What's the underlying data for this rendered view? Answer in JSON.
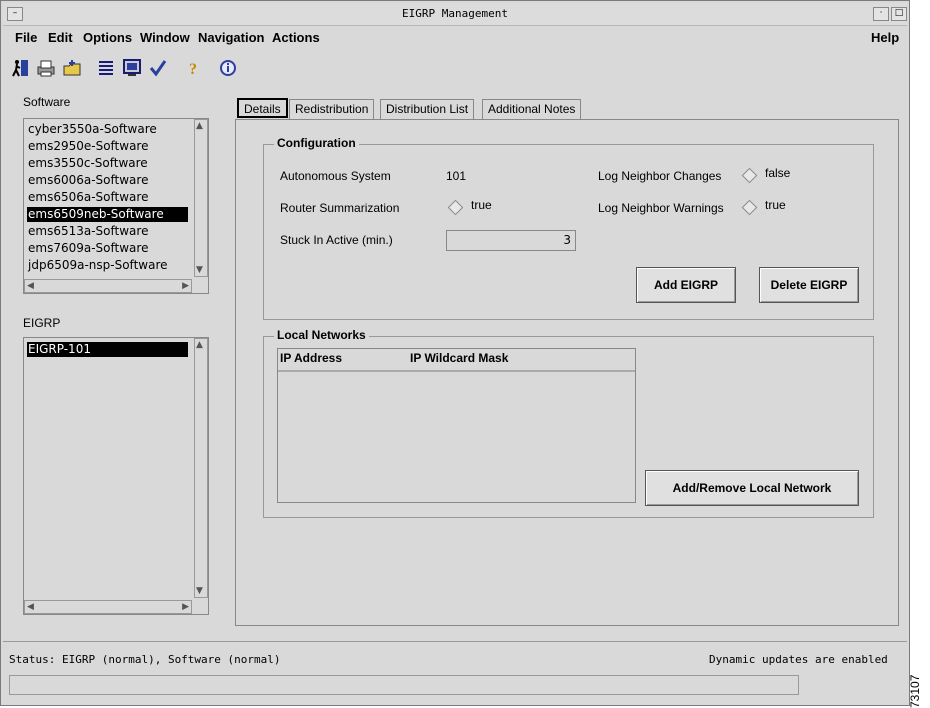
{
  "window": {
    "title": "EIGRP Management"
  },
  "menu": {
    "file": "File",
    "edit": "Edit",
    "options": "Options",
    "window": "Window",
    "navigation": "Navigation",
    "actions": "Actions",
    "help": "Help"
  },
  "toolbar": {
    "icons": [
      "exit-icon",
      "print-icon",
      "folder-icon",
      "list-icon",
      "monitor-icon",
      "check-icon",
      "help-icon",
      "info-icon"
    ]
  },
  "software": {
    "label": "Software",
    "items": [
      "cyber3550a-Software",
      "ems2950e-Software",
      "ems3550c-Software",
      "ems6006a-Software",
      "ems6506a-Software",
      "ems6509neb-Software",
      "ems6513a-Software",
      "ems7609a-Software",
      "jdp6509a-nsp-Software"
    ],
    "selected": "ems6509neb-Software"
  },
  "eigrp": {
    "label": "EIGRP",
    "items": [
      "EIGRP-101"
    ],
    "selected": "EIGRP-101"
  },
  "tabs": [
    "Details",
    "Redistribution",
    "Distribution List",
    "Additional Notes"
  ],
  "configuration": {
    "title": "Configuration",
    "autonomous_system_label": "Autonomous System",
    "autonomous_system_value": "101",
    "router_summarization_label": "Router Summarization",
    "router_summarization_value": "true",
    "stuck_in_active_label": "Stuck In Active (min.)",
    "stuck_in_active_value": "3",
    "log_neighbor_changes_label": "Log Neighbor Changes",
    "log_neighbor_changes_value": "false",
    "log_neighbor_warnings_label": "Log Neighbor Warnings",
    "log_neighbor_warnings_value": "true",
    "add_button": "Add EIGRP",
    "delete_button": "Delete EIGRP"
  },
  "local_networks": {
    "title": "Local Networks",
    "columns": [
      "IP Address",
      "IP Wildcard Mask"
    ],
    "rows": [],
    "add_remove_button": "Add/Remove Local Network"
  },
  "status": {
    "text": "Status: EIGRP (normal), Software (normal)",
    "updates": "Dynamic updates are enabled"
  },
  "figure_code": "73107",
  "colors": {
    "selection_bg": "#000000",
    "window_bg": "#d9d9d9"
  }
}
